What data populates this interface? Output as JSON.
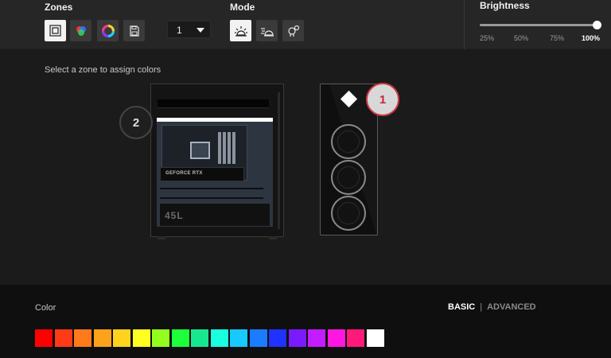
{
  "toolbar": {
    "zones_label": "Zones",
    "zone_buttons": [
      {
        "icon": "all-zones-icon",
        "active": true
      },
      {
        "icon": "multicolor-icon",
        "active": false
      },
      {
        "icon": "color-wheel-icon",
        "active": false
      },
      {
        "icon": "save-icon",
        "active": false
      }
    ],
    "profile_dropdown_value": "1",
    "mode_label": "Mode",
    "mode_buttons": [
      {
        "icon": "static-light-icon",
        "active": true
      },
      {
        "icon": "breathing-light-icon",
        "active": false
      },
      {
        "icon": "effect-light-icon",
        "active": false
      }
    ],
    "brightness_label": "Brightness",
    "brightness_value_percent": 100,
    "brightness_ticks": [
      "25%",
      "50%",
      "75%",
      "100%"
    ],
    "brightness_active_tick": "100%"
  },
  "main": {
    "hint": "Select a zone to assign colors",
    "zone_badges": [
      {
        "number": "2",
        "selected": false
      },
      {
        "number": "1",
        "selected": true
      }
    ],
    "case_side_labels": {
      "gpu": "GEFORCE RTX",
      "psu": "45L"
    }
  },
  "color_panel": {
    "label": "Color",
    "tab_basic": "BASIC",
    "tab_separator": "|",
    "tab_advanced": "ADVANCED",
    "swatches": [
      "#ff0000",
      "#ff3a16",
      "#ff7a1a",
      "#ffa21b",
      "#ffd21e",
      "#ffff21",
      "#94ff1f",
      "#1cff3a",
      "#17e88f",
      "#19ffe0",
      "#17c9ff",
      "#1b7cff",
      "#1e33ff",
      "#7a1bff",
      "#c31cff",
      "#ff17e1",
      "#ff1a7a",
      "#ffffff"
    ],
    "selected_swatch": 17
  }
}
